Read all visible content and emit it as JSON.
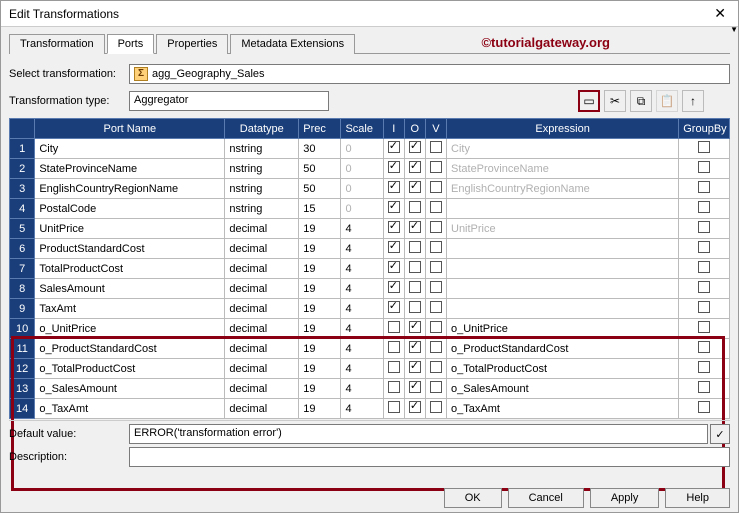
{
  "window": {
    "title": "Edit Transformations"
  },
  "watermark": "©tutorialgateway.org",
  "tabs": [
    {
      "label": "Transformation"
    },
    {
      "label": "Ports"
    },
    {
      "label": "Properties"
    },
    {
      "label": "Metadata Extensions"
    }
  ],
  "fields": {
    "select_label": "Select transformation:",
    "select_value": "agg_Geography_Sales",
    "type_label": "Transformation type:",
    "type_value": "Aggregator"
  },
  "columns": {
    "port": "Port Name",
    "datatype": "Datatype",
    "prec": "Prec",
    "scale": "Scale",
    "i": "I",
    "o": "O",
    "v": "V",
    "expr": "Expression",
    "groupby": "GroupBy"
  },
  "rows": [
    {
      "n": "1",
      "port": "City",
      "dtype": "nstring",
      "prec": "30",
      "scale": "0",
      "i": true,
      "o": true,
      "v": false,
      "expr": "City",
      "dim": true,
      "scaledim": true
    },
    {
      "n": "2",
      "port": "StateProvinceName",
      "dtype": "nstring",
      "prec": "50",
      "scale": "0",
      "i": true,
      "o": true,
      "v": false,
      "expr": "StateProvinceName",
      "dim": true,
      "scaledim": true
    },
    {
      "n": "3",
      "port": "EnglishCountryRegionName",
      "dtype": "nstring",
      "prec": "50",
      "scale": "0",
      "i": true,
      "o": true,
      "v": false,
      "expr": "EnglishCountryRegionName",
      "dim": true,
      "scaledim": true
    },
    {
      "n": "4",
      "port": "PostalCode",
      "dtype": "nstring",
      "prec": "15",
      "scale": "0",
      "i": true,
      "o": false,
      "v": false,
      "expr": "",
      "dim": false,
      "scaledim": true
    },
    {
      "n": "5",
      "port": "UnitPrice",
      "dtype": "decimal",
      "prec": "19",
      "scale": "4",
      "i": true,
      "o": true,
      "v": false,
      "expr": "UnitPrice",
      "dim": true,
      "scaledim": false
    },
    {
      "n": "6",
      "port": "ProductStandardCost",
      "dtype": "decimal",
      "prec": "19",
      "scale": "4",
      "i": true,
      "o": false,
      "v": false,
      "expr": "",
      "dim": false,
      "scaledim": false
    },
    {
      "n": "7",
      "port": "TotalProductCost",
      "dtype": "decimal",
      "prec": "19",
      "scale": "4",
      "i": true,
      "o": false,
      "v": false,
      "expr": "",
      "dim": false,
      "scaledim": false
    },
    {
      "n": "8",
      "port": "SalesAmount",
      "dtype": "decimal",
      "prec": "19",
      "scale": "4",
      "i": true,
      "o": false,
      "v": false,
      "expr": "",
      "dim": false,
      "scaledim": false
    },
    {
      "n": "9",
      "port": "TaxAmt",
      "dtype": "decimal",
      "prec": "19",
      "scale": "4",
      "i": true,
      "o": false,
      "v": false,
      "expr": "",
      "dim": false,
      "scaledim": false
    },
    {
      "n": "10",
      "port": "o_UnitPrice",
      "dtype": "decimal",
      "prec": "19",
      "scale": "4",
      "i": false,
      "o": true,
      "v": false,
      "expr": "o_UnitPrice",
      "dim": false,
      "scaledim": false
    },
    {
      "n": "11",
      "port": "o_ProductStandardCost",
      "dtype": "decimal",
      "prec": "19",
      "scale": "4",
      "i": false,
      "o": true,
      "v": false,
      "expr": "o_ProductStandardCost",
      "dim": false,
      "scaledim": false
    },
    {
      "n": "12",
      "port": "o_TotalProductCost",
      "dtype": "decimal",
      "prec": "19",
      "scale": "4",
      "i": false,
      "o": true,
      "v": false,
      "expr": "o_TotalProductCost",
      "dim": false,
      "scaledim": false
    },
    {
      "n": "13",
      "port": "o_SalesAmount",
      "dtype": "decimal",
      "prec": "19",
      "scale": "4",
      "i": false,
      "o": true,
      "v": false,
      "expr": "o_SalesAmount",
      "dim": false,
      "scaledim": false
    },
    {
      "n": "14",
      "port": "o_TaxAmt",
      "dtype": "decimal",
      "prec": "19",
      "scale": "4",
      "i": false,
      "o": true,
      "v": false,
      "expr": "o_TaxAmt",
      "dim": false,
      "scaledim": false
    }
  ],
  "bottom": {
    "default_label": "Default value:",
    "default_value": "ERROR('transformation error')",
    "desc_label": "Description:",
    "desc_value": ""
  },
  "buttons": {
    "ok": "OK",
    "cancel": "Cancel",
    "apply": "Apply",
    "help": "Help"
  }
}
